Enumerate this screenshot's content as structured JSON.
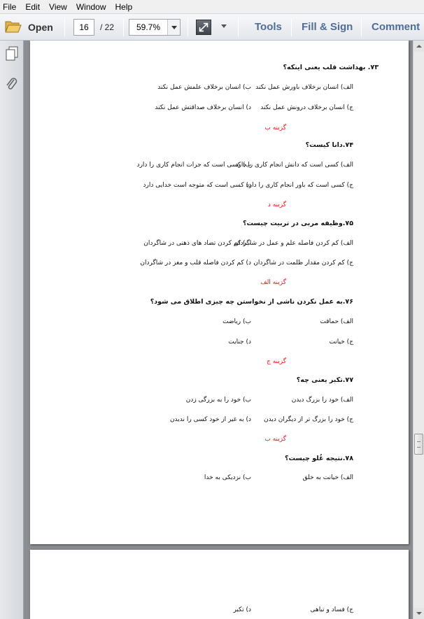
{
  "menu": [
    "File",
    "Edit",
    "View",
    "Window",
    "Help"
  ],
  "toolbar": {
    "open_label": "Open",
    "current_page": "16",
    "total_pages": "/ 22",
    "zoom": "59.7%",
    "tools_label": "Tools",
    "fill_sign_label": "Fill & Sign",
    "comment_label": "Comment"
  },
  "colors": {
    "answer": "#e8141c",
    "toolbar_link": "#4f6d96"
  },
  "questions": [
    {
      "q": "۷۳.        بهداشت قلب یعنی اینکه؟",
      "a": "الف) انسان برخلاف باورش عمل نکند",
      "b": "ب) انسان برخلاف علمش عمل نکند",
      "c": "ج) انسان برخلاف درونش عمل نکند",
      "d": "د) انسان برخلاف صداقتش عمل نکند",
      "answer": "گزینه ب"
    },
    {
      "q": "۷۴.دانا کیست؟",
      "a": "الف) کسی است که دانش انجام کاری را دارد",
      "b": "ب) کسی است که جرات انجام کاری را دارد",
      "c": "ج) کسی است که باور انجام کاری را دارد",
      "d": "د) کسی است که متوجه است خدایی دارد",
      "answer": "گزینه د"
    },
    {
      "q": "۷۵.وظیفه مربی در تربیت چیست؟",
      "a": "الف) کم کردن فاصله علم و عمل در شاگردان",
      "b": "ب) کم کردن تضاد های ذهنی در شاگردان",
      "c": "ج) کم کردن مقدار ظلمت در شاگردان",
      "d": "د) کم کردن فاصله قلب و مغز در شاگردان",
      "answer": "گزینه الف"
    },
    {
      "q": "۷۶.به عمل نکردن ناشی از نخواستن چه چیزی اطلاق می شود؟",
      "a": "الف) حماقت",
      "b": "ب) ریاضت",
      "c": "ج) خیانت",
      "d": "د) جنایت",
      "answer": "گزینه ج"
    },
    {
      "q": "۷۷.تکبر یعنی چه؟",
      "a": "الف) خود را بزرگ دیدن",
      "b": "ب) خود را به بزرگی زدن",
      "c": "ج) خود را بزرگ تر از دیگران دیدن",
      "d": "د) به غیر از خود کسی را ندیدن",
      "answer": "گزینه ب"
    },
    {
      "q": "۷۸.نتیجه غُلو چیست؟",
      "a": "الف) خیانت به خلق",
      "b": "ب) نزدیکی به خدا"
    }
  ],
  "page2": {
    "c": "ج) فساد و تباهی",
    "d": "د) تکبر"
  }
}
